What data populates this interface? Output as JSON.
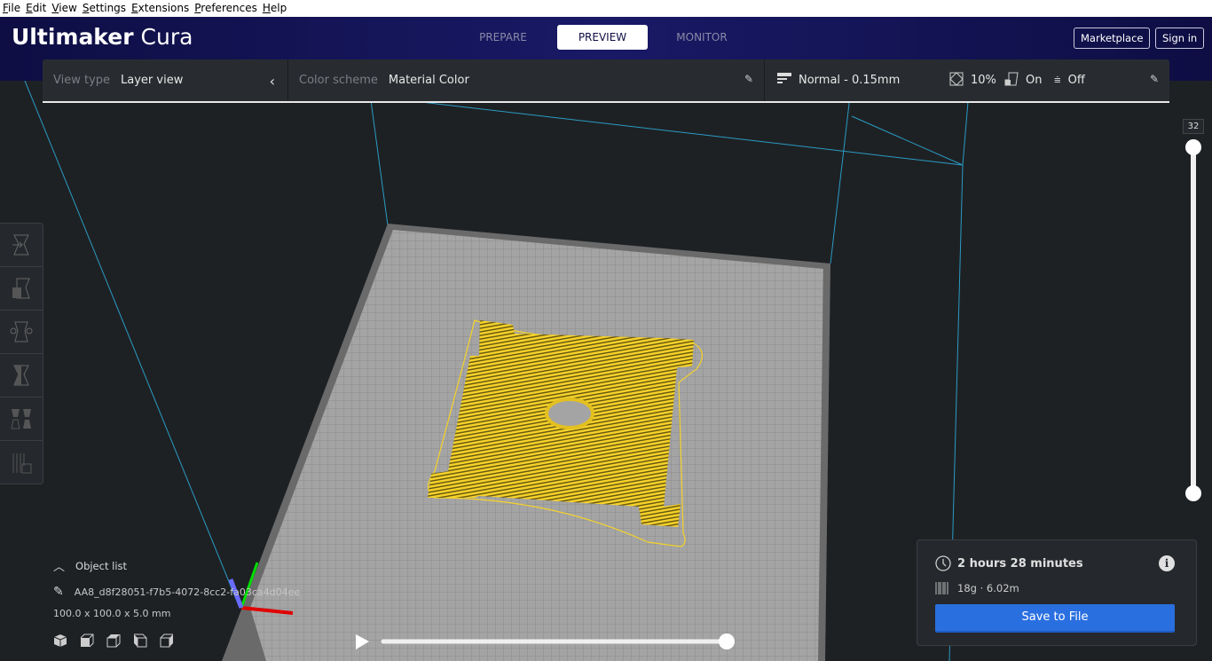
{
  "menu": [
    "File",
    "Edit",
    "View",
    "Settings",
    "Extensions",
    "Preferences",
    "Help"
  ],
  "app": {
    "brand_bold": "Ultimaker",
    "brand_light": "Cura"
  },
  "stages": [
    {
      "label": "PREPARE"
    },
    {
      "label": "PREVIEW"
    },
    {
      "label": "MONITOR"
    }
  ],
  "header_buttons": {
    "marketplace": "Marketplace",
    "signin": "Sign in"
  },
  "viewbar": {
    "view_type_label": "View type",
    "view_type_value": "Layer view",
    "color_scheme_label": "Color scheme",
    "color_scheme_value": "Material Color"
  },
  "print_settings": {
    "profile": "Normal - 0.15mm",
    "infill": "10%",
    "support": "On",
    "adhesion": "Off"
  },
  "layer_slider": {
    "current_layer": "32"
  },
  "object_list": {
    "title": "Object list",
    "object_name": "AA8_d8f28051-f7b5-4072-8cc2-fa03ca4d04ee",
    "dimensions": "100.0 x 100.0 x 5.0 mm"
  },
  "print_info": {
    "time": "2 hours 28 minutes",
    "material": "18g · 6.02m",
    "save_label": "Save to File"
  },
  "colors": {
    "header_bg": "#191966",
    "accent_blue": "#2a6fe0",
    "material": "#f5d22a",
    "build_plate": "#9a9a9a"
  },
  "playback": {
    "progress": 1.0
  }
}
